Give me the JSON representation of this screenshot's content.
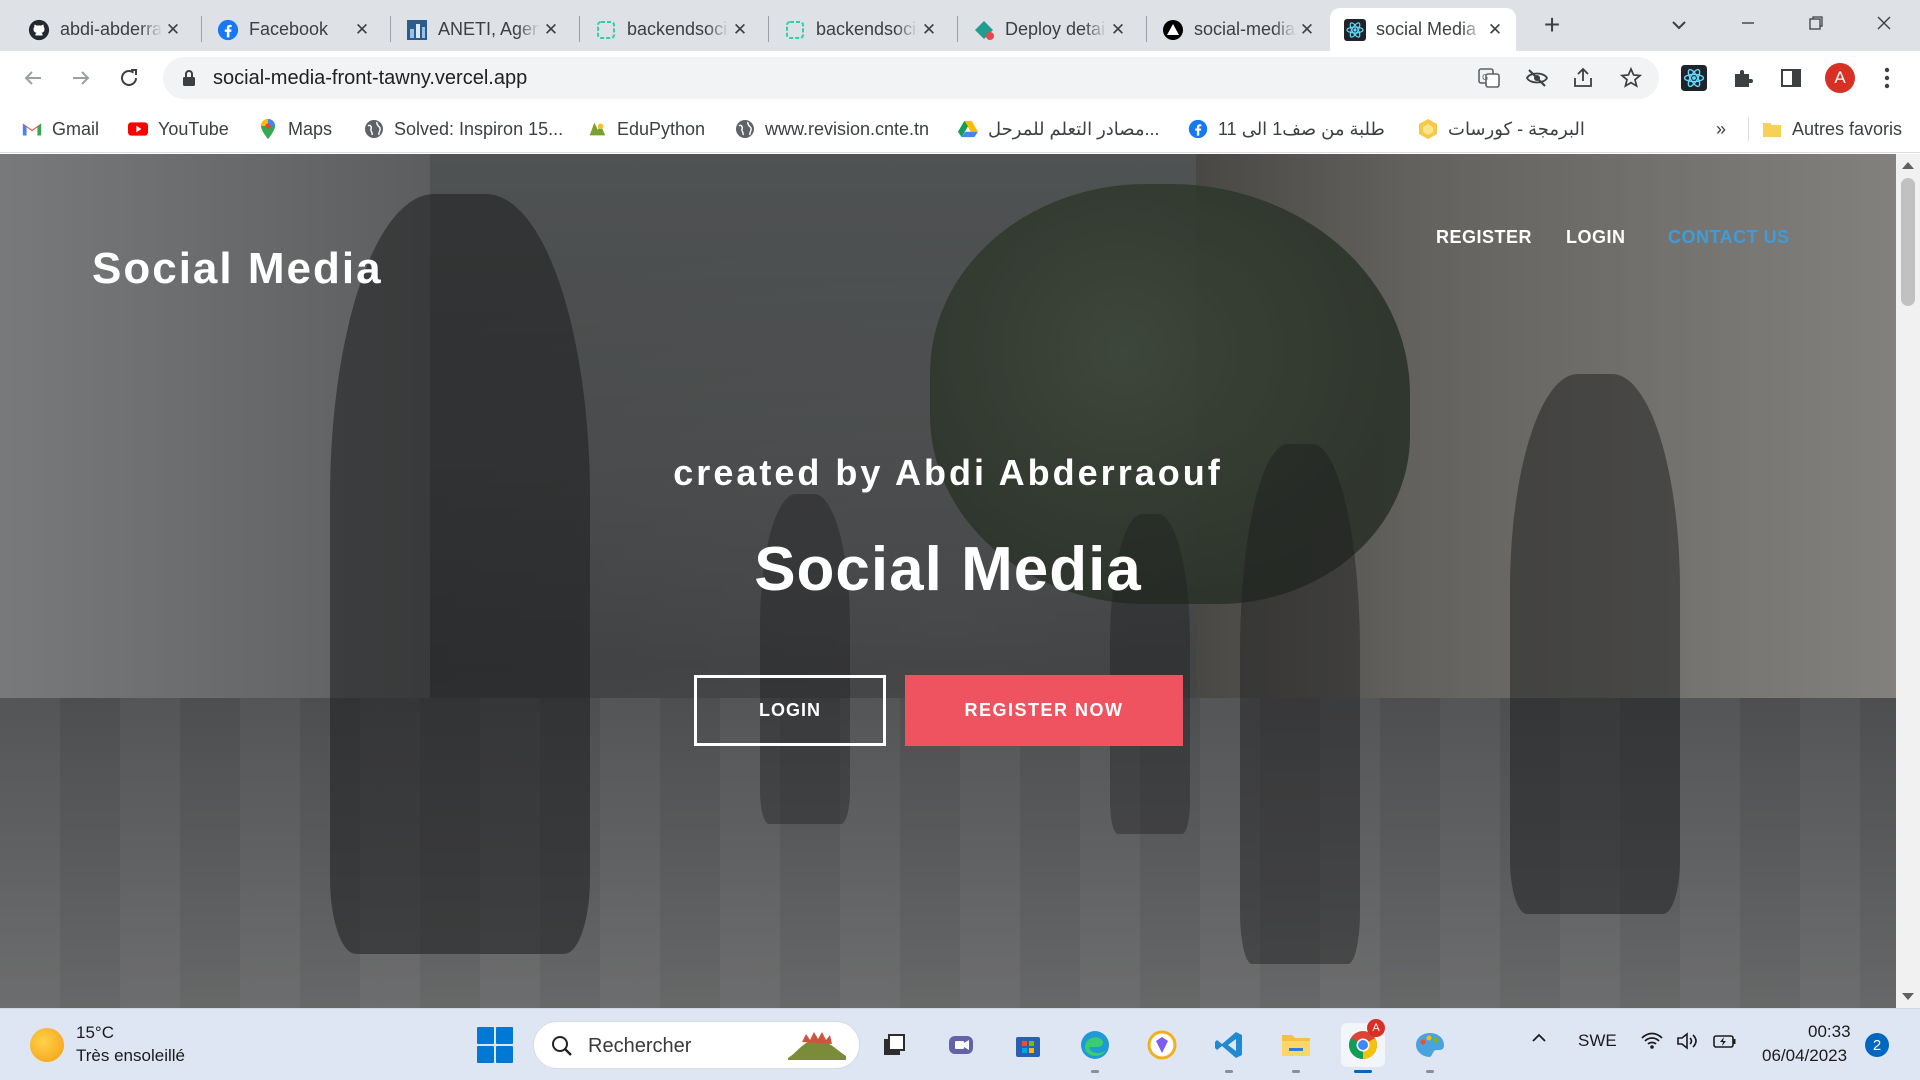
{
  "browser": {
    "tabs": [
      {
        "title": "abdi-abderraouf",
        "icon": "github-icon"
      },
      {
        "title": "Facebook",
        "icon": "facebook-icon"
      },
      {
        "title": "ANETI, Agence",
        "icon": "aneti-icon"
      },
      {
        "title": "backendsocial",
        "icon": "railway-icon"
      },
      {
        "title": "backendsocial",
        "icon": "railway-icon"
      },
      {
        "title": "Deploy details",
        "icon": "deploy-icon"
      },
      {
        "title": "social-media",
        "icon": "vercel-icon"
      },
      {
        "title": "social Media",
        "icon": "react-icon",
        "active": true
      }
    ],
    "url": "social-media-front-tawny.vercel.app",
    "profile_initial": "A",
    "bookmarks": [
      {
        "label": "Gmail",
        "icon": "gmail-icon"
      },
      {
        "label": "YouTube",
        "icon": "youtube-icon"
      },
      {
        "label": "Maps",
        "icon": "maps-icon"
      },
      {
        "label": "Solved: Inspiron 15...",
        "icon": "globe-icon"
      },
      {
        "label": "EduPython",
        "icon": "edupython-icon"
      },
      {
        "label": "www.revision.cnte.tn",
        "icon": "globe-icon"
      },
      {
        "label": "مصادر التعلم للمرحل...",
        "icon": "drive-icon"
      },
      {
        "label": "طلبة من صف1 الى 11",
        "icon": "facebook-icon"
      },
      {
        "label": "البرمجة - كورسات",
        "icon": "course-icon"
      }
    ],
    "bookmarks_overflow": "»",
    "other_bookmarks": "Autres favoris"
  },
  "page": {
    "brand": "Social Media",
    "nav": [
      {
        "label": "REGISTER"
      },
      {
        "label": "LOGIN"
      },
      {
        "label": "CONTACT US",
        "color": "#3d9cdc"
      }
    ],
    "hero_subtitle": "created by Abdi Abderraouf",
    "hero_title": "Social Media",
    "login_button": "LOGIN",
    "register_button": "REGISTER NOW",
    "register_button_color": "#ef5360"
  },
  "taskbar": {
    "weather_temp": "15°C",
    "weather_desc": "Très ensoleillé",
    "search_placeholder": "Rechercher",
    "language": "SWE",
    "time": "00:33",
    "date": "06/04/2023",
    "notification_count": "2",
    "chrome_badge": "A"
  }
}
